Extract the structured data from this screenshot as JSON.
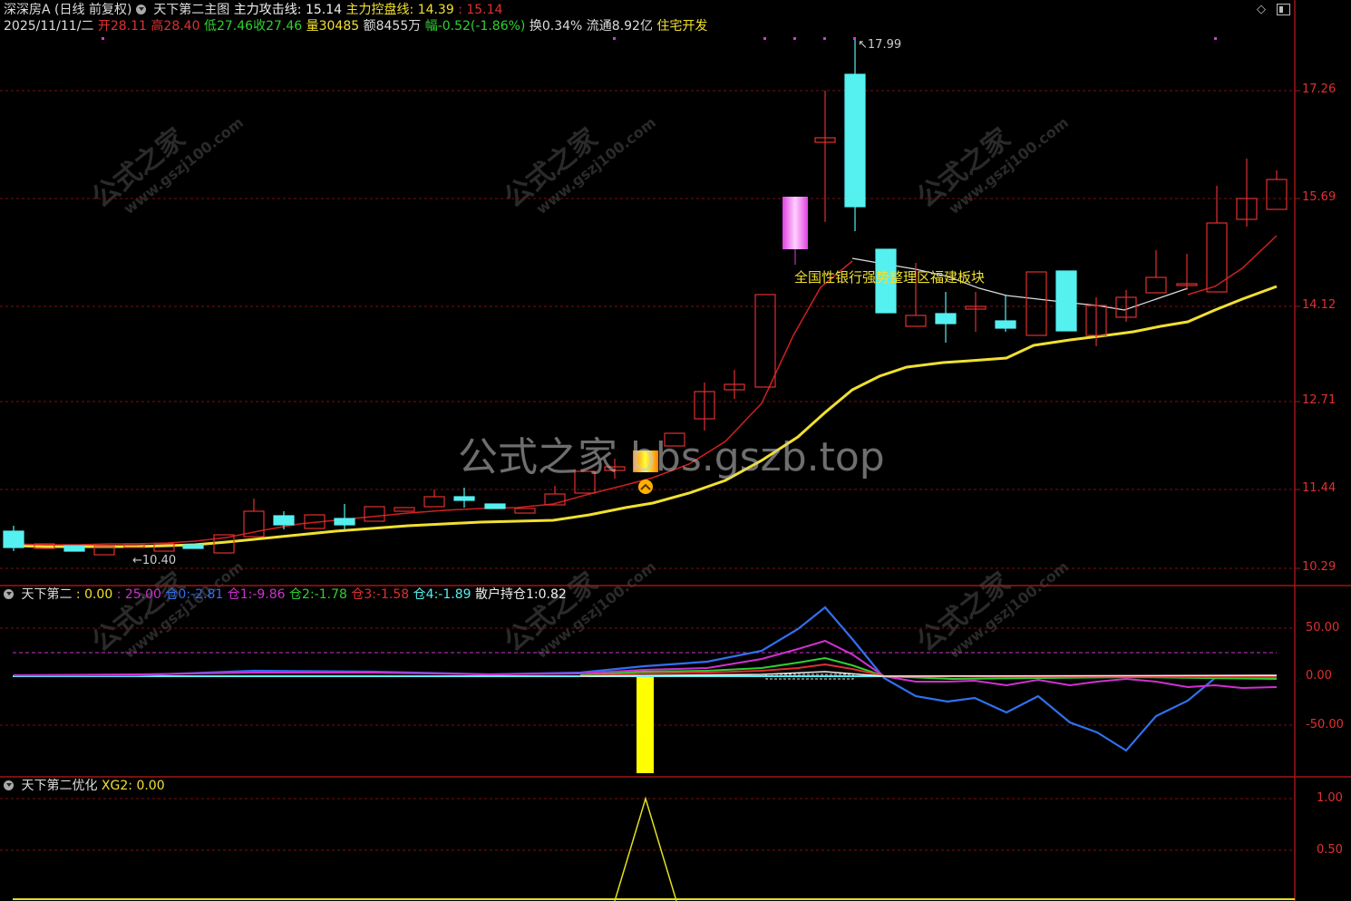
{
  "stock": {
    "name": "深深房A",
    "period": "(日线 前复权)",
    "main_indicator": "天下第二主图",
    "attack_line_label": "主力攻击线:",
    "attack_line_value": "15.14",
    "control_line_label": "主力控盘线:",
    "control_line_value": "14.39",
    "control_line_extra": ": 15.14"
  },
  "quote": {
    "date": "2025/11/11/二",
    "open_label": "开",
    "open": "28.11",
    "high_label": "高",
    "high": "28.40",
    "low_label": "低",
    "low": "27.46",
    "close_label": "收",
    "close": "27.46",
    "volume_label": "量",
    "volume": "30485",
    "amount_label": "额",
    "amount": "8455万",
    "change_label": "幅",
    "change": "-0.52(-1.86%)",
    "turnover_label": "换",
    "turnover": "0.34%",
    "float_label": "流通",
    "float": "8.92亿",
    "sector": "住宅开发"
  },
  "main_axis": [
    "17.26",
    "15.69",
    "14.12",
    "12.71",
    "11.44",
    "10.29"
  ],
  "annotations": {
    "high_mark": "17.99",
    "low_mark": "10.40",
    "sector_text": "全国性银行强势整理区福建板块"
  },
  "watermark": {
    "center": "公式之家 bbs.gszb.top",
    "tile_cn": "公式之家",
    "tile_url": "www.gszj100.com"
  },
  "indicator1": {
    "name": "天下第二",
    "v0_label": ": 0.00",
    "v1_label": ": 25.00",
    "c0_label": "仓0:",
    "c0": "-2.81",
    "c1_label": "仓1:",
    "c1": "-9.86",
    "c2_label": "仓2:",
    "c2": "-1.78",
    "c3_label": "仓3:",
    "c3": "-1.58",
    "c4_label": "仓4:",
    "c4": "-1.89",
    "retail_label": "散户持仓1:",
    "retail": "0.82",
    "axis": [
      "50.00",
      "0.00",
      "-50.00"
    ]
  },
  "indicator2": {
    "name": "天下第二优化",
    "xg_label": "XG2:",
    "xg": "0.00",
    "axis": [
      "1.00",
      "0.50"
    ]
  },
  "colors": {
    "up": "#e03030",
    "down": "#55f0f0",
    "ma_yellow": "#f0e030",
    "ma_red": "#d02020",
    "grid": "#8a1010"
  }
}
